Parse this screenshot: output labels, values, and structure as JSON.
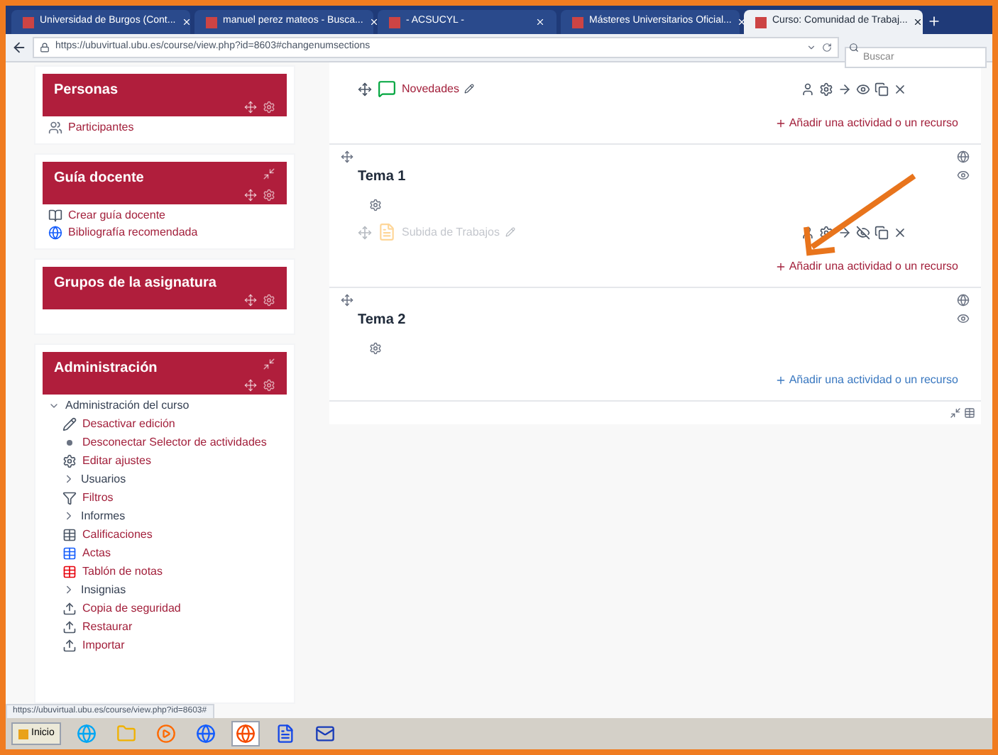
{
  "browser": {
    "tabs": [
      {
        "title": "Universidad de Burgos (Cont...",
        "selected": false
      },
      {
        "title": "manuel perez mateos - Busca...",
        "selected": false
      },
      {
        "title": "- ACSUCYL -",
        "selected": false
      },
      {
        "title": "Másteres Universitarios Oficial...",
        "selected": false
      },
      {
        "title": "Curso: Comunidad de Trabaj...",
        "selected": true
      }
    ],
    "url": "https://ubuvirtual.ubu.es/course/view.php?id=8603#changenumsections",
    "search": {
      "placeholder": "Buscar"
    }
  },
  "blocks": [
    {
      "title": "Personas",
      "items": [
        {
          "label": "Participantes",
          "kind": "people",
          "link": true
        }
      ]
    },
    {
      "title": "Guía docente",
      "items": [
        {
          "label": "Crear guía docente",
          "kind": "book",
          "link": true
        },
        {
          "label": "Bibliografía recomendada",
          "kind": "globe",
          "link": true
        }
      ]
    },
    {
      "title": "Grupos de la asignatura"
    }
  ],
  "administration": {
    "title": "Administración",
    "tree": [
      {
        "label": "Administración del curso",
        "expanded": true,
        "children": [
          {
            "label": "Desactivar edición",
            "kind": "pencil",
            "link": true
          },
          {
            "label": "Desconectar Selector de actividades",
            "kind": "bullet",
            "link": true
          },
          {
            "label": "Editar ajustes",
            "kind": "gear",
            "link": true
          },
          {
            "label": "Usuarios",
            "kind": "folder",
            "expanded": false,
            "link": false
          },
          {
            "label": "Filtros",
            "kind": "filter",
            "link": true
          },
          {
            "label": "Informes",
            "kind": "folder",
            "expanded": false,
            "link": false
          },
          {
            "label": "Calificaciones",
            "kind": "grades",
            "link": true
          },
          {
            "label": "Actas",
            "kind": "sheet",
            "link": true
          },
          {
            "label": "Tablón de notas",
            "kind": "board",
            "link": true
          },
          {
            "label": "Insignias",
            "kind": "folder",
            "expanded": false,
            "link": false
          },
          {
            "label": "Copia de seguridad",
            "kind": "upload",
            "link": true
          },
          {
            "label": "Restaurar",
            "kind": "upload",
            "link": true
          },
          {
            "label": "Importar",
            "kind": "upload",
            "link": true
          }
        ]
      }
    ]
  },
  "sections": [
    {
      "activities": [
        {
          "name": "Novedades",
          "kind": "forum",
          "hidden": false
        }
      ],
      "add_link": {
        "label": "Añadir una actividad o un recurso",
        "hovered": false
      }
    },
    {
      "title": "Tema 1",
      "activities": [
        {
          "name": "Subida de Trabajos",
          "kind": "assignment",
          "hidden": true
        }
      ],
      "add_link": {
        "label": "Añadir una actividad o un recurso",
        "hovered": false
      }
    },
    {
      "title": "Tema 2",
      "add_link": {
        "label": "Añadir una actividad o un recurso",
        "hovered": true
      }
    }
  ],
  "status_url": "https://ubuvirtual.ubu.es/course/view.php?id=8603#",
  "taskbar": {
    "start_label": "Inicio",
    "apps": [
      {
        "kind": "ie",
        "selected": false
      },
      {
        "kind": "folder",
        "selected": false
      },
      {
        "kind": "media",
        "selected": false
      },
      {
        "kind": "globe",
        "selected": false
      },
      {
        "kind": "firefox",
        "selected": true
      },
      {
        "kind": "word",
        "selected": false
      },
      {
        "kind": "mail",
        "selected": false
      }
    ]
  }
}
